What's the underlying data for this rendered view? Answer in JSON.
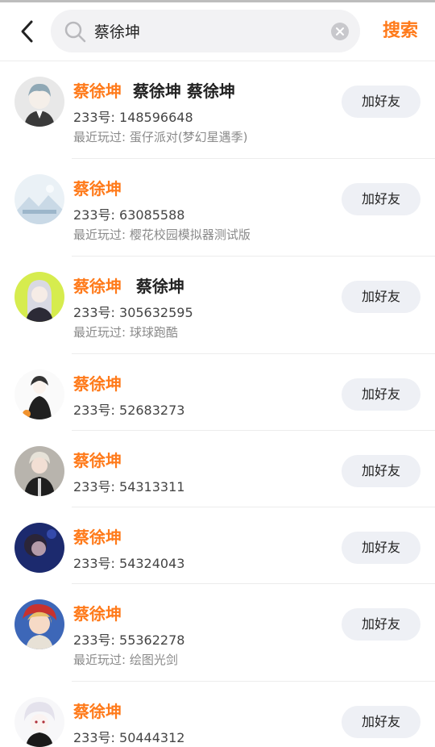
{
  "search": {
    "query": "蔡徐坤",
    "submit_label": "搜索"
  },
  "results": [
    {
      "name": "蔡徐坤",
      "name_extra": "蔡徐坤 蔡徐坤",
      "id_text": "233号: 148596648",
      "last_played": "最近玩过: 蛋仔派对(梦幻星遇季)",
      "add_label": "加好友"
    },
    {
      "name": "蔡徐坤",
      "name_extra": "",
      "id_text": "233号: 63085588",
      "last_played": "最近玩过: 樱花校园模拟器测试版",
      "add_label": "加好友"
    },
    {
      "name": "蔡徐坤",
      "name_extra": "蔡徐坤",
      "id_text": "233号: 305632595",
      "last_played": "最近玩过: 球球跑酷",
      "add_label": "加好友"
    },
    {
      "name": "蔡徐坤",
      "name_extra": "",
      "id_text": "233号: 52683273",
      "last_played": "",
      "add_label": "加好友"
    },
    {
      "name": "蔡徐坤",
      "name_extra": "",
      "id_text": "233号: 54313311",
      "last_played": "",
      "add_label": "加好友"
    },
    {
      "name": "蔡徐坤",
      "name_extra": "",
      "id_text": "233号: 54324043",
      "last_played": "",
      "add_label": "加好友"
    },
    {
      "name": "蔡徐坤",
      "name_extra": "",
      "id_text": "233号: 55362278",
      "last_played": "最近玩过: 绘图光剑",
      "add_label": "加好友"
    },
    {
      "name": "蔡徐坤",
      "name_extra": "",
      "id_text": "233号: 50444312",
      "last_played": "",
      "add_label": "加好友"
    }
  ]
}
